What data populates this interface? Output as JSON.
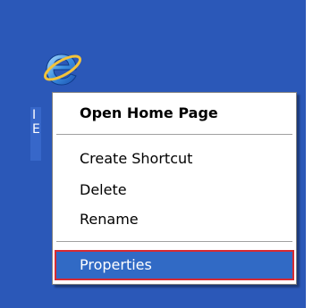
{
  "desktop": {
    "background_color": "#2b58b8",
    "icon": {
      "name": "internet-explorer-icon",
      "label_lines": [
        "I",
        "E"
      ]
    }
  },
  "context_menu": {
    "items": [
      {
        "label": "Open Home Page",
        "bold": true
      },
      {
        "label": "Create Shortcut"
      },
      {
        "label": "Delete"
      },
      {
        "label": "Rename"
      },
      {
        "label": "Properties",
        "selected": true
      }
    ],
    "selection_color": "#316ac5",
    "highlight_border_color": "#d62b32"
  }
}
